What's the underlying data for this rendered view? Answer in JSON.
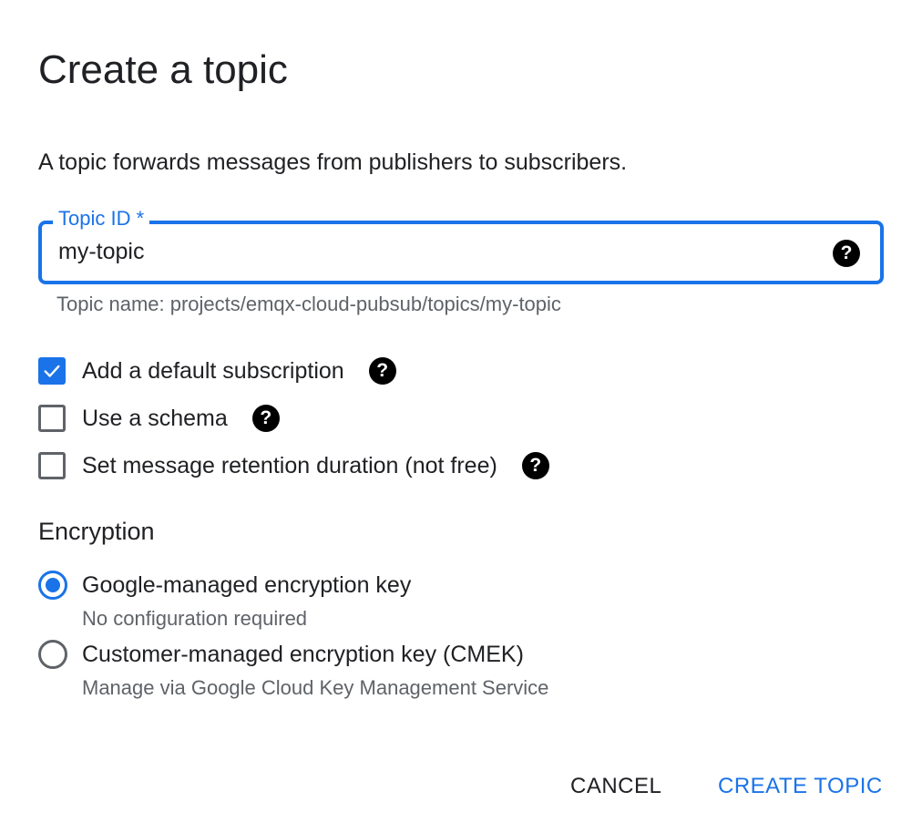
{
  "dialog": {
    "title": "Create a topic",
    "description": "A topic forwards messages from publishers to subscribers."
  },
  "topic_id": {
    "label": "Topic ID *",
    "value": "my-topic",
    "help_icon": "help-circle-icon",
    "hint": "Topic name: projects/emqx-cloud-pubsub/topics/my-topic"
  },
  "options": [
    {
      "label": "Add a default subscription",
      "checked": true,
      "help_icon": "help-circle-icon"
    },
    {
      "label": "Use a schema",
      "checked": false,
      "help_icon": "help-circle-icon"
    },
    {
      "label": "Set message retention duration (not free)",
      "checked": false,
      "help_icon": "help-circle-icon"
    }
  ],
  "encryption": {
    "title": "Encryption",
    "choices": [
      {
        "label": "Google-managed encryption key",
        "description": "No configuration required",
        "selected": true
      },
      {
        "label": "Customer-managed encryption key (CMEK)",
        "description": "Manage via Google Cloud Key Management Service",
        "selected": false
      }
    ]
  },
  "actions": {
    "cancel_label": "CANCEL",
    "create_label": "CREATE TOPIC"
  },
  "colors": {
    "accent": "#1a73e8",
    "text": "#202124",
    "secondary_text": "#5f6368"
  }
}
